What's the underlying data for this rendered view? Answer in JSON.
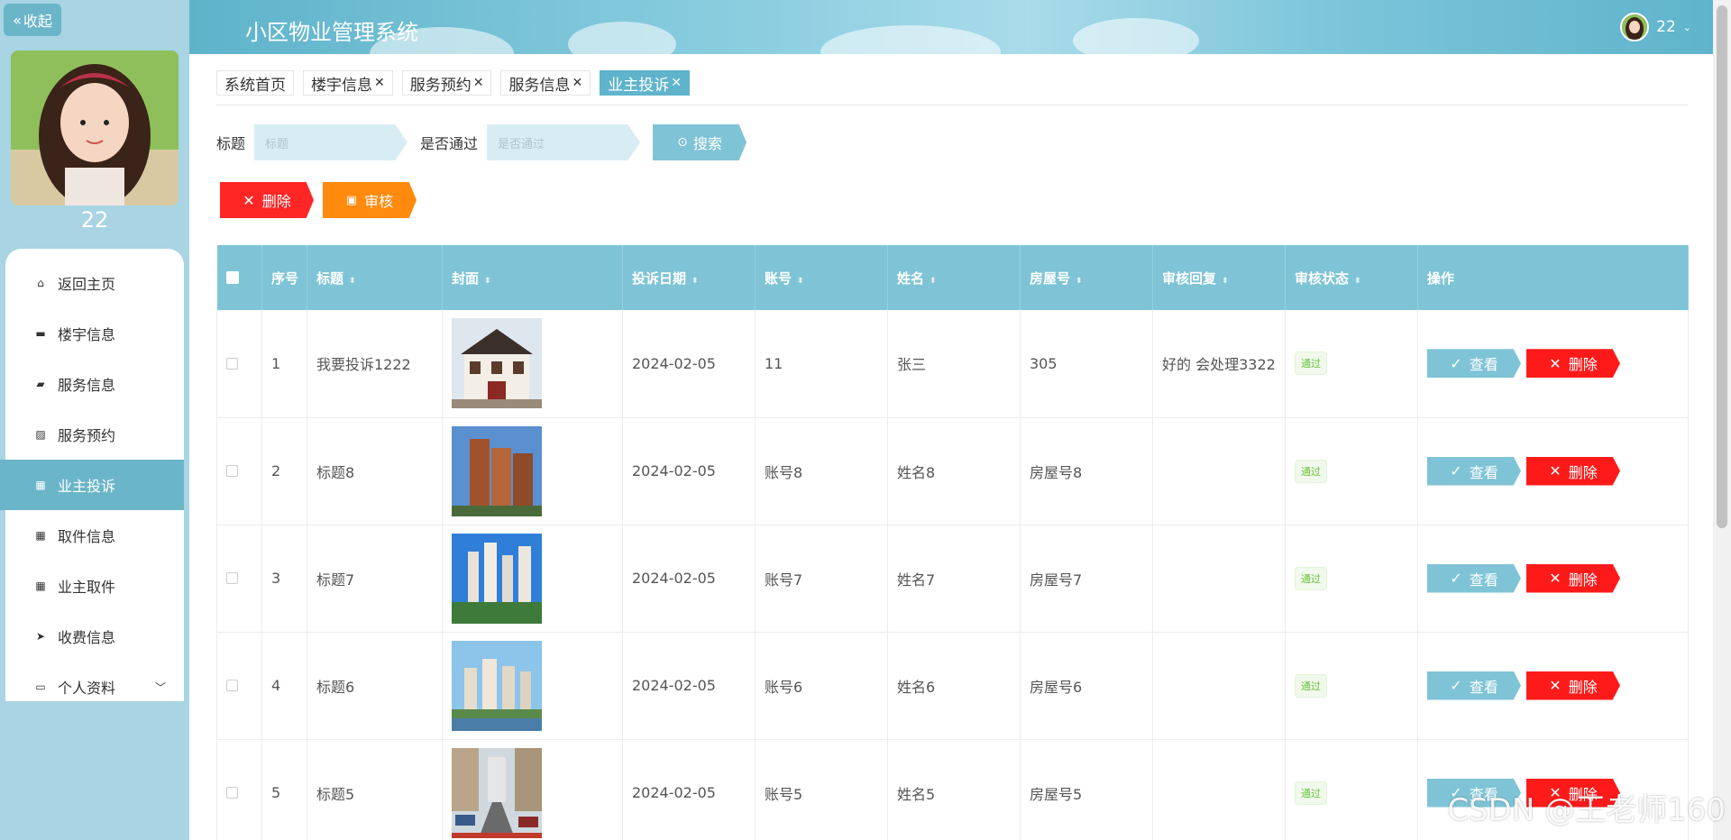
{
  "sidebar": {
    "collapse_label": "收起",
    "username": "22",
    "menu": [
      {
        "label": "返回主页",
        "icon": "home-icon"
      },
      {
        "label": "楼宇信息",
        "icon": "monitor-icon"
      },
      {
        "label": "服务信息",
        "icon": "briefcase-icon"
      },
      {
        "label": "服务预约",
        "icon": "chart-icon"
      },
      {
        "label": "业主投诉",
        "icon": "grid-icon",
        "active": true
      },
      {
        "label": "取件信息",
        "icon": "grid-icon"
      },
      {
        "label": "业主取件",
        "icon": "grid-icon"
      },
      {
        "label": "收费信息",
        "icon": "send-icon"
      },
      {
        "label": "个人资料",
        "icon": "card-icon"
      }
    ]
  },
  "header": {
    "title": "小区物业管理系统",
    "user": "22"
  },
  "tabs": [
    {
      "label": "系统首页",
      "closable": false
    },
    {
      "label": "楼宇信息",
      "closable": true
    },
    {
      "label": "服务预约",
      "closable": true
    },
    {
      "label": "服务信息",
      "closable": true
    },
    {
      "label": "业主投诉",
      "closable": true,
      "active": true
    }
  ],
  "search": {
    "title_label": "标题",
    "title_placeholder": "标题",
    "passed_label": "是否通过",
    "passed_placeholder": "是否通过",
    "search_button": "搜索"
  },
  "actions": {
    "delete": "删除",
    "audit": "审核"
  },
  "table": {
    "headers": [
      "序号",
      "标题",
      "封面",
      "投诉日期",
      "账号",
      "姓名",
      "房屋号",
      "审核回复",
      "审核状态",
      "操作"
    ],
    "view_label": "查看",
    "delete_label": "删除",
    "rows": [
      {
        "no": "1",
        "title": "我要投诉1222",
        "date": "2024-02-05",
        "account": "11",
        "name": "张三",
        "house": "305",
        "reply": "好的 会处理3322",
        "status": "通过"
      },
      {
        "no": "2",
        "title": "标题8",
        "date": "2024-02-05",
        "account": "账号8",
        "name": "姓名8",
        "house": "房屋号8",
        "reply": "",
        "status": "通过"
      },
      {
        "no": "3",
        "title": "标题7",
        "date": "2024-02-05",
        "account": "账号7",
        "name": "姓名7",
        "house": "房屋号7",
        "reply": "",
        "status": "通过"
      },
      {
        "no": "4",
        "title": "标题6",
        "date": "2024-02-05",
        "account": "账号6",
        "name": "姓名6",
        "house": "房屋号6",
        "reply": "",
        "status": "通过"
      },
      {
        "no": "5",
        "title": "标题5",
        "date": "2024-02-05",
        "account": "账号5",
        "name": "姓名5",
        "house": "房屋号5",
        "reply": "",
        "status": "通过"
      }
    ]
  },
  "watermark": "CSDN @王老师160"
}
